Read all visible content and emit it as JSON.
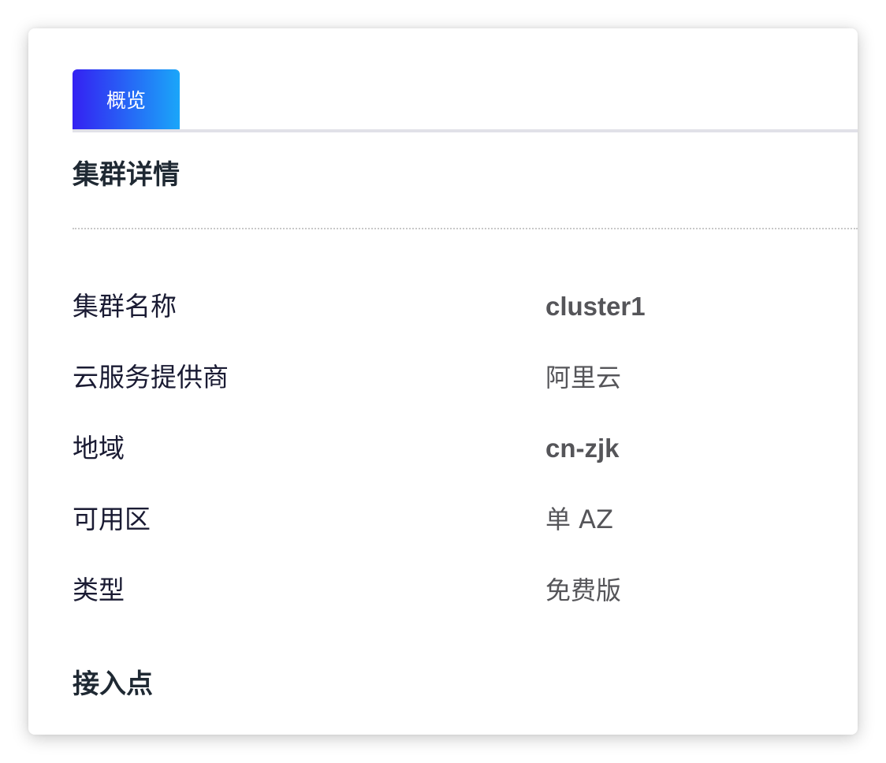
{
  "tabs": [
    {
      "label": "概览",
      "active": true
    }
  ],
  "section": {
    "title": "集群详情"
  },
  "details": [
    {
      "label": "集群名称",
      "value": "cluster1"
    },
    {
      "label": "云服务提供商",
      "value": "阿里云"
    },
    {
      "label": "地域",
      "value": "cn-zjk"
    },
    {
      "label": "可用区",
      "value": "单 AZ"
    },
    {
      "label": "类型",
      "value": "免费版"
    }
  ],
  "endpoints": {
    "title": "接入点"
  },
  "colors": {
    "tab_gradient_start": "#3421f2",
    "tab_gradient_end": "#1aa6f9",
    "tab_underline": "#e1e1e8",
    "label_text": "#1a1b33",
    "value_text": "#555559"
  }
}
